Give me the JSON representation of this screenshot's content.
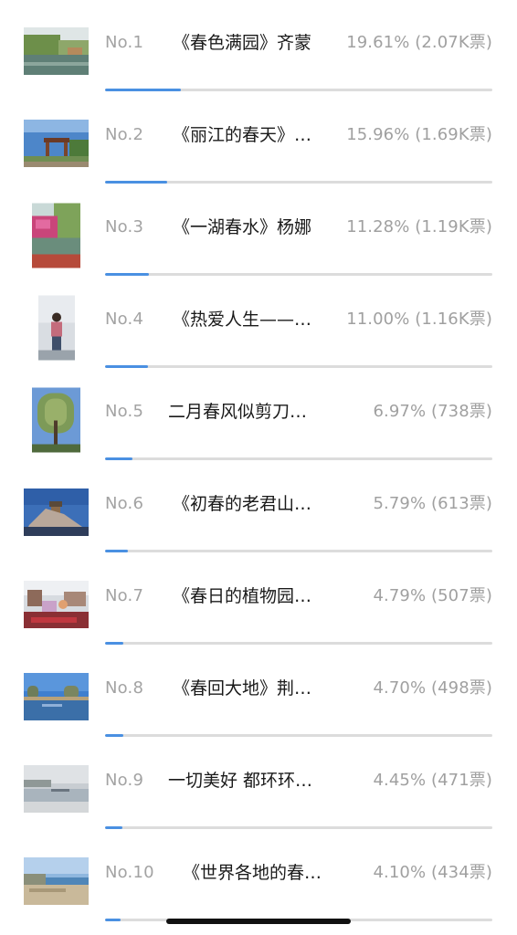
{
  "ranking": {
    "entries": [
      {
        "rank": "No.1",
        "title": "《春色满园》齐蒙",
        "stat": "19.61% (2.07K票)",
        "share": 0.1961,
        "photo": "spring-garden-pond-icon"
      },
      {
        "rank": "No.2",
        "title": "《丽江的春天》…",
        "stat": "15.96% (1.69K票)",
        "share": 0.1596,
        "photo": "pavilion-blue-sky-icon"
      },
      {
        "rank": "No.3",
        "title": "《一湖春水》杨娜",
        "stat": "11.28% (1.19K票)",
        "share": 0.1128,
        "photo": "lake-blossoms-icon"
      },
      {
        "rank": "No.4",
        "title": "《热爱人生——…",
        "stat": "11.00% (1.16K票)",
        "share": 0.11,
        "photo": "person-portrait-icon"
      },
      {
        "rank": "No.5",
        "title": "二月春风似剪刀…",
        "stat": "6.97% (738票)",
        "share": 0.0697,
        "photo": "willow-tree-icon"
      },
      {
        "rank": "No.6",
        "title": "《初春的老君山…",
        "stat": "5.79% (613票)",
        "share": 0.0579,
        "photo": "mountain-temple-icon"
      },
      {
        "rank": "No.7",
        "title": "《春日的植物园…",
        "stat": "4.79% (507票)",
        "share": 0.0479,
        "photo": "botanical-garden-icon"
      },
      {
        "rank": "No.8",
        "title": "《春回大地》荆…",
        "stat": "4.70% (498票)",
        "share": 0.047,
        "photo": "river-trees-icon"
      },
      {
        "rank": "No.9",
        "title": "一切美好 都环环…",
        "stat": "4.45% (471票)",
        "share": 0.0445,
        "photo": "misty-lake-icon"
      },
      {
        "rank": "No.10",
        "title": "《世界各地的春…",
        "stat": "4.10% (434票)",
        "share": 0.041,
        "photo": "seaside-town-icon"
      }
    ]
  },
  "colors": {
    "progress_fill": "#4a90e2",
    "progress_track": "#dcdcdc",
    "rank_text": "#a3a3a3",
    "title_text": "#1a1a1a",
    "stat_text": "#a0a0a0"
  }
}
